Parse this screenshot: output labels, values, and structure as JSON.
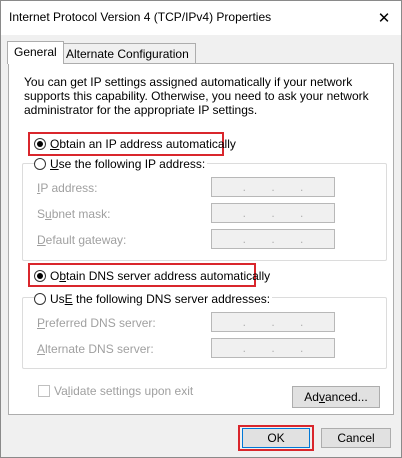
{
  "window": {
    "title": "Internet Protocol Version 4 (TCP/IPv4) Properties"
  },
  "tabs": [
    {
      "label": "General",
      "active": true
    },
    {
      "label": "Alternate Configuration",
      "active": false
    }
  ],
  "description": "You can get IP settings assigned automatically if your network supports this capability. Otherwise, you need to ask your network administrator for the appropriate IP settings.",
  "ip_section": {
    "auto": {
      "label": "Obtain an IP address automatically",
      "underline": "O",
      "rest": "btain an IP address automatically",
      "checked": true
    },
    "manual": {
      "label": "Use the following IP address:",
      "underline": "U",
      "rest": "se the following IP address:",
      "checked": false
    },
    "fields": [
      {
        "label": "IP address:",
        "underline": "I",
        "rest": "P address:",
        "value": ". . ."
      },
      {
        "label": "Subnet mask:",
        "underline": "u",
        "pre": "S",
        "rest": "bnet mask:",
        "value": ". . ."
      },
      {
        "label": "Default gateway:",
        "underline": "D",
        "rest": "efault gateway:",
        "value": ". . ."
      }
    ]
  },
  "dns_section": {
    "auto": {
      "label": "Obtain DNS server address automatically",
      "underline": "b",
      "pre": "O",
      "rest": "tain DNS server address automatically",
      "checked": true
    },
    "manual": {
      "label": "Use the following DNS server addresses:",
      "underline": "E",
      "pre": "Us",
      "rest": " the following DNS server addresses:",
      "checked": false
    },
    "fields": [
      {
        "label": "Preferred DNS server:",
        "underline": "P",
        "rest": "referred DNS server:",
        "value": ". . ."
      },
      {
        "label": "Alternate DNS server:",
        "underline": "A",
        "rest": "lternate DNS server:",
        "value": ". . ."
      }
    ]
  },
  "validate": {
    "label": "Validate settings upon exit",
    "pre": "Va",
    "underline": "l",
    "rest": "idate settings upon exit",
    "checked": false
  },
  "buttons": {
    "advanced": {
      "pre": "Ad",
      "underline": "v",
      "rest": "anced..."
    },
    "ok": "OK",
    "cancel": "Cancel"
  },
  "colors": {
    "highlight": "#d9262c",
    "panel": "#ffffff",
    "dialog": "#f0f0f0"
  }
}
